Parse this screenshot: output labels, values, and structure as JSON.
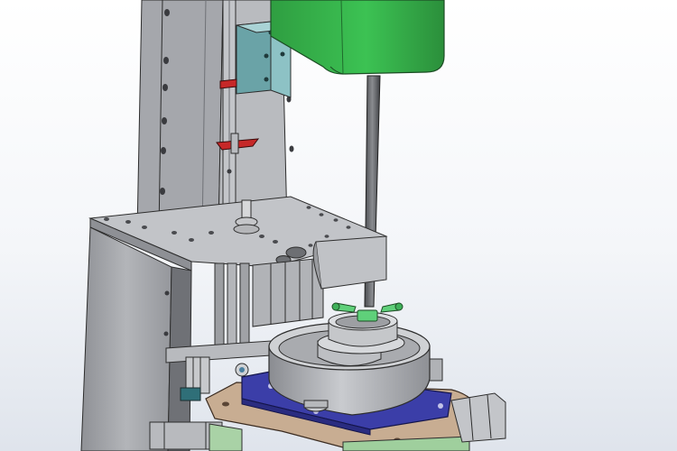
{
  "scene": {
    "colors": {
      "background_top": "#ffffff",
      "background_bottom": "#dfe4ec",
      "steel": "#a7a9ae",
      "steel_dark": "#7e8086",
      "motor_green": "#35b04a",
      "slide_teal": "#7fb3b6",
      "base_plate_blue": "#3d3fa8",
      "mount_plate_tan": "#c5a98e",
      "gripper_green": "#5fd07a",
      "stop_red": "#c62828"
    }
  }
}
